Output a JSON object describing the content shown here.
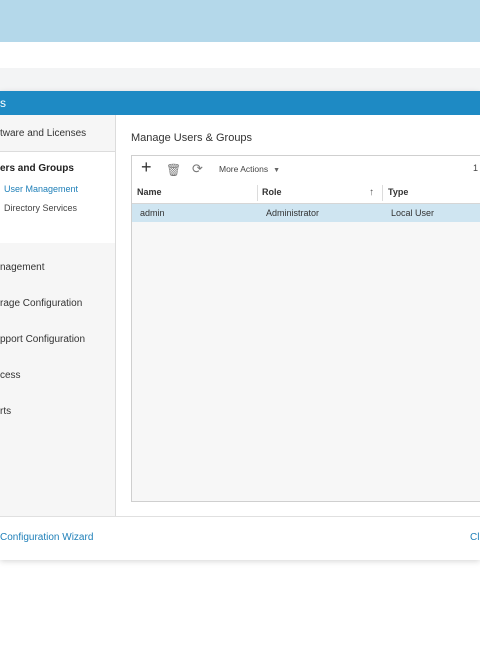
{
  "window": {
    "title_fragment": "s"
  },
  "sidebar": {
    "items": [
      {
        "label": "tware and Licenses"
      },
      {
        "label": "ers and Groups",
        "children": [
          {
            "label": "User Management",
            "active": true
          },
          {
            "label": "Directory Services",
            "active": false
          }
        ]
      },
      {
        "label": "nagement"
      },
      {
        "label": "rage Configuration"
      },
      {
        "label": "pport Configuration"
      },
      {
        "label": "cess"
      },
      {
        "label": "rts"
      }
    ]
  },
  "main": {
    "section_title": "Manage Users & Groups",
    "toolbar": {
      "add_icon": "plus-icon",
      "delete_icon": "trash-icon",
      "refresh_icon": "refresh-icon",
      "more_actions_label": "More Actions",
      "count_fragment": "1"
    },
    "table": {
      "columns": [
        "Name",
        "Role",
        "Type"
      ],
      "sort_column": "Role",
      "sort_direction": "ascending",
      "rows": [
        {
          "name": "admin",
          "role": "Administrator",
          "type": "Local User",
          "selected": true
        }
      ]
    }
  },
  "footer": {
    "wizard_link": "Configuration Wizard",
    "close_fragment": "Cl"
  },
  "colors": {
    "accent": "#1e8ac4",
    "link": "#1e7fb8",
    "selected_row": "#cfe5f1",
    "top_band": "#b4d8ea"
  }
}
